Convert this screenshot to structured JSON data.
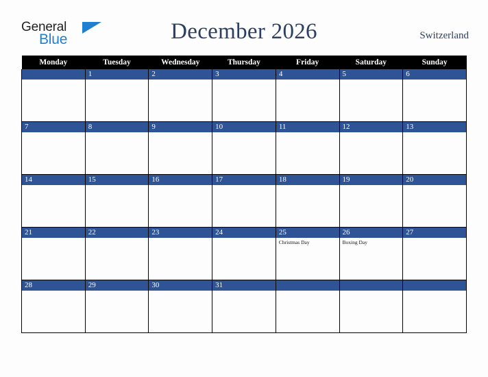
{
  "brand": {
    "name_part1": "General",
    "name_part2": "Blue",
    "triangle_icon": "brand-triangle-icon",
    "colors": {
      "general_text": "#222222",
      "blue_text": "#1f7fd0",
      "triangle": "#1f7fd0"
    }
  },
  "header": {
    "title": "December 2026",
    "region": "Switzerland",
    "title_color": "#2c3f62"
  },
  "calendar": {
    "month": "December",
    "year": "2026",
    "colors": {
      "weekday_header_bg": "#000000",
      "weekday_header_text": "#ffffff",
      "day_number_bar": "#2e5496",
      "day_number_text": "#ffffff",
      "cell_bg": "#fdfdfd",
      "grid_line": "#000000"
    },
    "weekdays": [
      "Monday",
      "Tuesday",
      "Wednesday",
      "Thursday",
      "Friday",
      "Saturday",
      "Sunday"
    ],
    "weeks": [
      [
        {
          "day": "",
          "events": []
        },
        {
          "day": "1",
          "events": []
        },
        {
          "day": "2",
          "events": []
        },
        {
          "day": "3",
          "events": []
        },
        {
          "day": "4",
          "events": []
        },
        {
          "day": "5",
          "events": []
        },
        {
          "day": "6",
          "events": []
        }
      ],
      [
        {
          "day": "7",
          "events": []
        },
        {
          "day": "8",
          "events": []
        },
        {
          "day": "9",
          "events": []
        },
        {
          "day": "10",
          "events": []
        },
        {
          "day": "11",
          "events": []
        },
        {
          "day": "12",
          "events": []
        },
        {
          "day": "13",
          "events": []
        }
      ],
      [
        {
          "day": "14",
          "events": []
        },
        {
          "day": "15",
          "events": []
        },
        {
          "day": "16",
          "events": []
        },
        {
          "day": "17",
          "events": []
        },
        {
          "day": "18",
          "events": []
        },
        {
          "day": "19",
          "events": []
        },
        {
          "day": "20",
          "events": []
        }
      ],
      [
        {
          "day": "21",
          "events": []
        },
        {
          "day": "22",
          "events": []
        },
        {
          "day": "23",
          "events": []
        },
        {
          "day": "24",
          "events": []
        },
        {
          "day": "25",
          "events": [
            "Christmas Day"
          ]
        },
        {
          "day": "26",
          "events": [
            "Boxing Day"
          ]
        },
        {
          "day": "27",
          "events": []
        }
      ],
      [
        {
          "day": "28",
          "events": []
        },
        {
          "day": "29",
          "events": []
        },
        {
          "day": "30",
          "events": []
        },
        {
          "day": "31",
          "events": []
        },
        {
          "day": "",
          "events": []
        },
        {
          "day": "",
          "events": []
        },
        {
          "day": "",
          "events": []
        }
      ]
    ]
  }
}
